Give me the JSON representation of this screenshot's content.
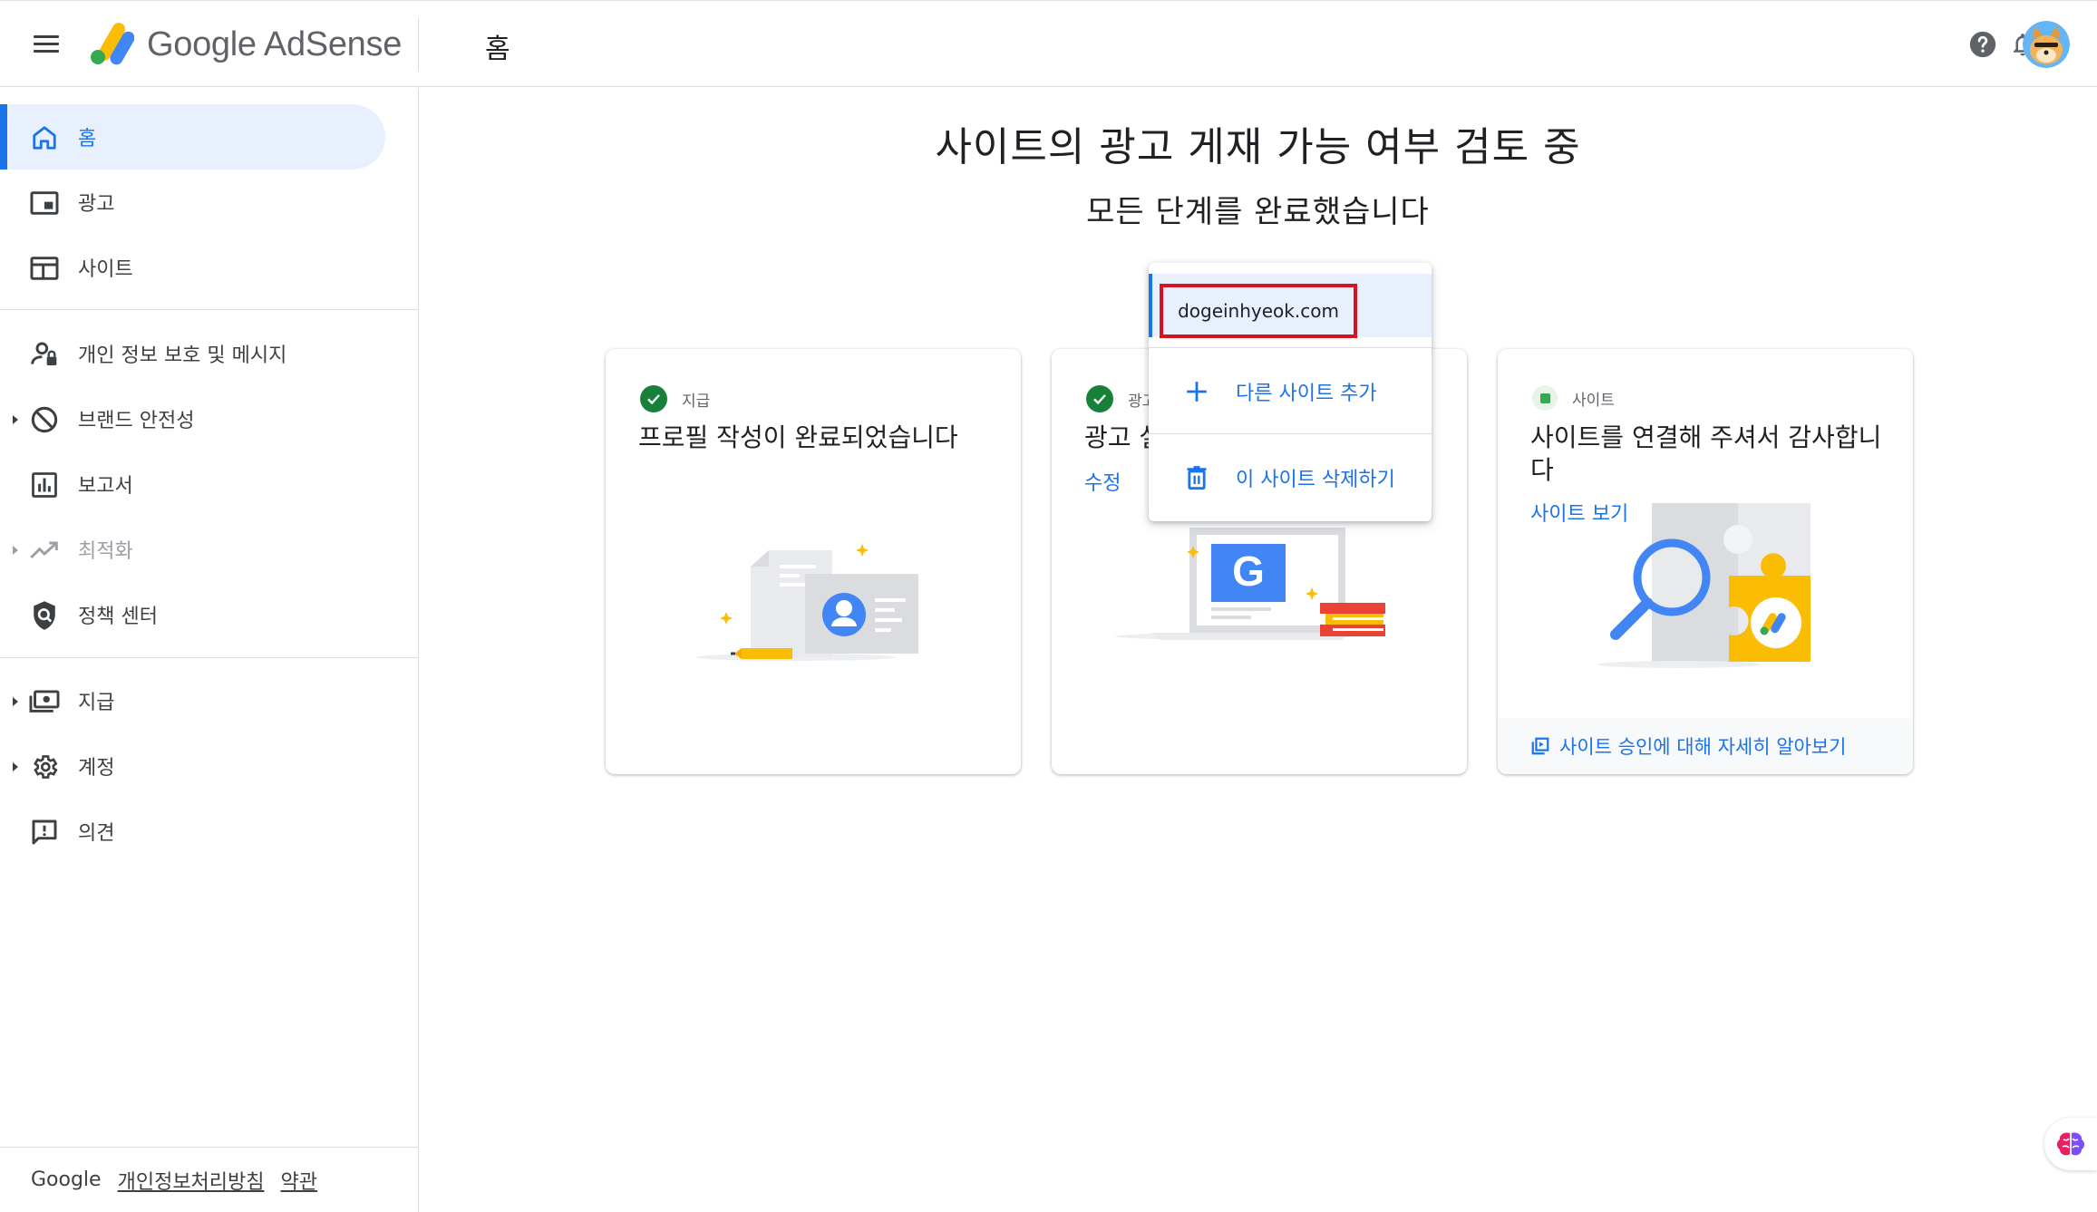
{
  "app": {
    "brand": "Google AdSense",
    "page_title": "홈"
  },
  "icons": {
    "menu": "hamburger-menu-icon",
    "help": "help-circle-icon",
    "notifications": "bell-icon",
    "avatar": "shiba-avatar"
  },
  "sidebar": {
    "items": [
      {
        "label": "홈",
        "icon": "home-icon",
        "active": true
      },
      {
        "label": "광고",
        "icon": "ads-icon"
      },
      {
        "label": "사이트",
        "icon": "sites-icon"
      },
      {
        "label": "개인 정보 보호 및 메시지",
        "icon": "privacy-user-icon"
      },
      {
        "label": "브랜드 안전성",
        "icon": "block-icon",
        "expandable": true
      },
      {
        "label": "보고서",
        "icon": "bar-chart-icon"
      },
      {
        "label": "최적화",
        "icon": "trending-up-icon",
        "expandable": true,
        "disabled": true
      },
      {
        "label": "정책 센터",
        "icon": "policy-shield-icon"
      },
      {
        "label": "지급",
        "icon": "payments-icon",
        "expandable": true
      },
      {
        "label": "계정",
        "icon": "gear-icon",
        "expandable": true
      },
      {
        "label": "의견",
        "icon": "feedback-icon"
      }
    ],
    "footer": {
      "brand": "Google",
      "privacy_link": "개인정보처리방침",
      "terms_link": "약관"
    }
  },
  "main": {
    "title": "사이트의 광고 게재 가능 여부 검토 중",
    "subtitle": "모든 단계를 완료했습니다",
    "cards": [
      {
        "status": "지급",
        "status_type": "complete",
        "title": "프로필 작성이 완료되었습니다"
      },
      {
        "status": "광고",
        "status_type": "complete",
        "title": "광고 설",
        "link": "수정"
      },
      {
        "status": "사이트",
        "status_type": "pending",
        "title": "사이트를 연결해 주셔서 감사합니다",
        "link": "사이트 보기",
        "footer_link": "사이트 승인에 대해 자세히 알아보기"
      }
    ]
  },
  "dropdown": {
    "selected_site": "dogeinhyeok.com",
    "add_site_label": "다른 사이트 추가",
    "delete_site_label": "이 사이트 삭제하기"
  },
  "colors": {
    "accent": "#1a73e8",
    "active_bg": "#e8f0fe",
    "success": "#188038",
    "highlight_border": "#d9121f"
  }
}
